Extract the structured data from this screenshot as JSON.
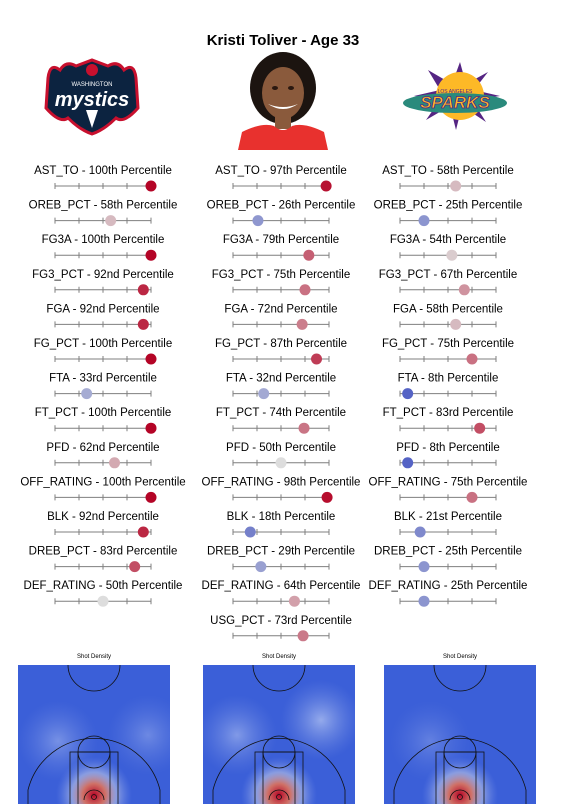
{
  "title": "Kristi Toliver - Age 33",
  "logos": {
    "left": {
      "name": "mystics-logo",
      "text": "mystics",
      "small_text": "WASHINGTON",
      "colors": [
        "#0c2340",
        "#c8102e",
        "#ffffff"
      ]
    },
    "right": {
      "name": "sparks-logo",
      "text": "SPARKS",
      "small_text": "LOS ANGELES",
      "colors": [
        "#552583",
        "#fdb927",
        "#2a8a7c"
      ]
    }
  },
  "player_photo": {
    "jersey_color": "#e8312e"
  },
  "colors": {
    "high": "#b40426",
    "mid": "#dddddd",
    "low": "#3b4cc0",
    "track": "#7f7f7f"
  },
  "chart_data": [
    {
      "type": "scatter",
      "panel": "left",
      "value_range": [
        0,
        100
      ],
      "metrics": [
        {
          "label": "AST_TO - 100th Percentile",
          "metric": "AST_TO",
          "percentile": 100
        },
        {
          "label": "OREB_PCT - 58th Percentile",
          "metric": "OREB_PCT",
          "percentile": 58
        },
        {
          "label": "FG3A - 100th Percentile",
          "metric": "FG3A",
          "percentile": 100
        },
        {
          "label": "FG3_PCT - 92nd Percentile",
          "metric": "FG3_PCT",
          "percentile": 92
        },
        {
          "label": "FGA - 92nd Percentile",
          "metric": "FGA",
          "percentile": 92
        },
        {
          "label": "FG_PCT - 100th Percentile",
          "metric": "FG_PCT",
          "percentile": 100
        },
        {
          "label": "FTA - 33rd Percentile",
          "metric": "FTA",
          "percentile": 33
        },
        {
          "label": "FT_PCT - 100th Percentile",
          "metric": "FT_PCT",
          "percentile": 100
        },
        {
          "label": "PFD - 62nd Percentile",
          "metric": "PFD",
          "percentile": 62
        },
        {
          "label": "OFF_RATING - 100th Percentile",
          "metric": "OFF_RATING",
          "percentile": 100
        },
        {
          "label": "BLK - 92nd Percentile",
          "metric": "BLK",
          "percentile": 92
        },
        {
          "label": "DREB_PCT - 83rd Percentile",
          "metric": "DREB_PCT",
          "percentile": 83
        },
        {
          "label": "DEF_RATING - 50th Percentile",
          "metric": "DEF_RATING",
          "percentile": 50
        }
      ]
    },
    {
      "type": "scatter",
      "panel": "middle",
      "value_range": [
        0,
        100
      ],
      "metrics": [
        {
          "label": "AST_TO - 97th Percentile",
          "metric": "AST_TO",
          "percentile": 97
        },
        {
          "label": "OREB_PCT - 26th Percentile",
          "metric": "OREB_PCT",
          "percentile": 26
        },
        {
          "label": "FG3A - 79th Percentile",
          "metric": "FG3A",
          "percentile": 79
        },
        {
          "label": "FG3_PCT - 75th Percentile",
          "metric": "FG3_PCT",
          "percentile": 75
        },
        {
          "label": "FGA - 72nd Percentile",
          "metric": "FGA",
          "percentile": 72
        },
        {
          "label": "FG_PCT - 87th Percentile",
          "metric": "FG_PCT",
          "percentile": 87
        },
        {
          "label": "FTA - 32nd Percentile",
          "metric": "FTA",
          "percentile": 32
        },
        {
          "label": "FT_PCT - 74th Percentile",
          "metric": "FT_PCT",
          "percentile": 74
        },
        {
          "label": "PFD - 50th Percentile",
          "metric": "PFD",
          "percentile": 50
        },
        {
          "label": "OFF_RATING - 98th Percentile",
          "metric": "OFF_RATING",
          "percentile": 98
        },
        {
          "label": "BLK - 18th Percentile",
          "metric": "BLK",
          "percentile": 18
        },
        {
          "label": "DREB_PCT - 29th Percentile",
          "metric": "DREB_PCT",
          "percentile": 29
        },
        {
          "label": "DEF_RATING - 64th Percentile",
          "metric": "DEF_RATING",
          "percentile": 64
        },
        {
          "label": "USG_PCT - 73rd Percentile",
          "metric": "USG_PCT",
          "percentile": 73
        }
      ]
    },
    {
      "type": "scatter",
      "panel": "right",
      "value_range": [
        0,
        100
      ],
      "metrics": [
        {
          "label": "AST_TO - 58th Percentile",
          "metric": "AST_TO",
          "percentile": 58
        },
        {
          "label": "OREB_PCT - 25th Percentile",
          "metric": "OREB_PCT",
          "percentile": 25
        },
        {
          "label": "FG3A - 54th Percentile",
          "metric": "FG3A",
          "percentile": 54
        },
        {
          "label": "FG3_PCT - 67th Percentile",
          "metric": "FG3_PCT",
          "percentile": 67
        },
        {
          "label": "FGA - 58th Percentile",
          "metric": "FGA",
          "percentile": 58
        },
        {
          "label": "FG_PCT - 75th Percentile",
          "metric": "FG_PCT",
          "percentile": 75
        },
        {
          "label": "FTA - 8th Percentile",
          "metric": "FTA",
          "percentile": 8
        },
        {
          "label": "FT_PCT - 83rd Percentile",
          "metric": "FT_PCT",
          "percentile": 83
        },
        {
          "label": "PFD - 8th Percentile",
          "metric": "PFD",
          "percentile": 8
        },
        {
          "label": "OFF_RATING - 75th Percentile",
          "metric": "OFF_RATING",
          "percentile": 75
        },
        {
          "label": "BLK - 21st Percentile",
          "metric": "BLK",
          "percentile": 21
        },
        {
          "label": "DREB_PCT - 25th Percentile",
          "metric": "DREB_PCT",
          "percentile": 25
        },
        {
          "label": "DEF_RATING - 25th Percentile",
          "metric": "DEF_RATING",
          "percentile": 25
        }
      ]
    },
    {
      "type": "heatmap",
      "title": "Shot Density",
      "panel": "left",
      "background_color": "#3b5fd8",
      "hotspots": [
        {
          "x": 0,
          "y": 0,
          "intensity": 1.0
        },
        {
          "x": -12,
          "y": 18,
          "intensity": 0.3
        },
        {
          "x": 18,
          "y": 20,
          "intensity": 0.25
        }
      ]
    },
    {
      "type": "heatmap",
      "title": "Shot Density",
      "panel": "middle",
      "background_color": "#3b5fd8",
      "hotspots": [
        {
          "x": 0,
          "y": 0,
          "intensity": 1.0
        },
        {
          "x": 14,
          "y": 25,
          "intensity": 0.45
        },
        {
          "x": -14,
          "y": 20,
          "intensity": 0.35
        }
      ]
    },
    {
      "type": "heatmap",
      "title": "Shot Density",
      "panel": "right",
      "background_color": "#3b5fd8",
      "hotspots": [
        {
          "x": 0,
          "y": 0,
          "intensity": 1.0
        },
        {
          "x": -10,
          "y": 18,
          "intensity": 0.2
        }
      ]
    }
  ]
}
